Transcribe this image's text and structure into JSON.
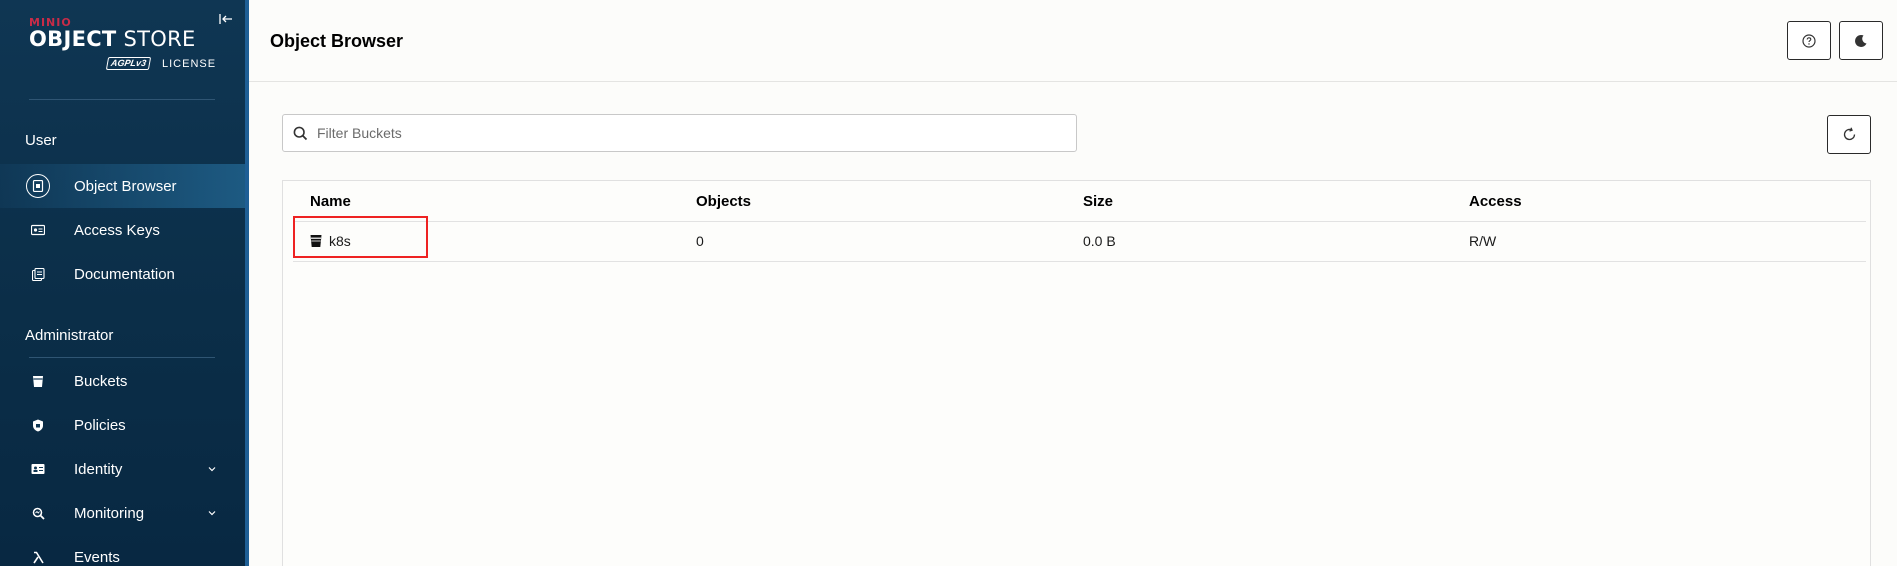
{
  "brand": {
    "minio": "MINIO",
    "product_bold": "OBJECT",
    "product_rest": " STORE",
    "license_badge": "AGPLv3",
    "license": "LICENSE"
  },
  "sidebar": {
    "user_section": "User",
    "user_items": [
      {
        "label": "Object Browser",
        "icon": "object-browser-icon",
        "active": true
      },
      {
        "label": "Access Keys",
        "icon": "access-keys-icon"
      },
      {
        "label": "Documentation",
        "icon": "documentation-icon"
      }
    ],
    "admin_section": "Administrator",
    "admin_items": [
      {
        "label": "Buckets",
        "icon": "bucket-icon"
      },
      {
        "label": "Policies",
        "icon": "policy-shield-icon"
      },
      {
        "label": "Identity",
        "icon": "identity-card-icon",
        "expandable": true
      },
      {
        "label": "Monitoring",
        "icon": "monitoring-search-icon",
        "expandable": true
      },
      {
        "label": "Events",
        "icon": "lambda-icon"
      }
    ]
  },
  "header": {
    "title": "Object Browser"
  },
  "filter": {
    "placeholder": "Filter Buckets",
    "value": ""
  },
  "table": {
    "columns": [
      "Name",
      "Objects",
      "Size",
      "Access"
    ],
    "rows": [
      {
        "name": "k8s",
        "objects": "0",
        "size": "0.0 B",
        "access": "R/W"
      }
    ]
  },
  "colors": {
    "sidebar_bg": "#0f3653",
    "active_item": "#1d5a82",
    "brand_red": "#c72c48",
    "highlight": "#ee2222"
  }
}
